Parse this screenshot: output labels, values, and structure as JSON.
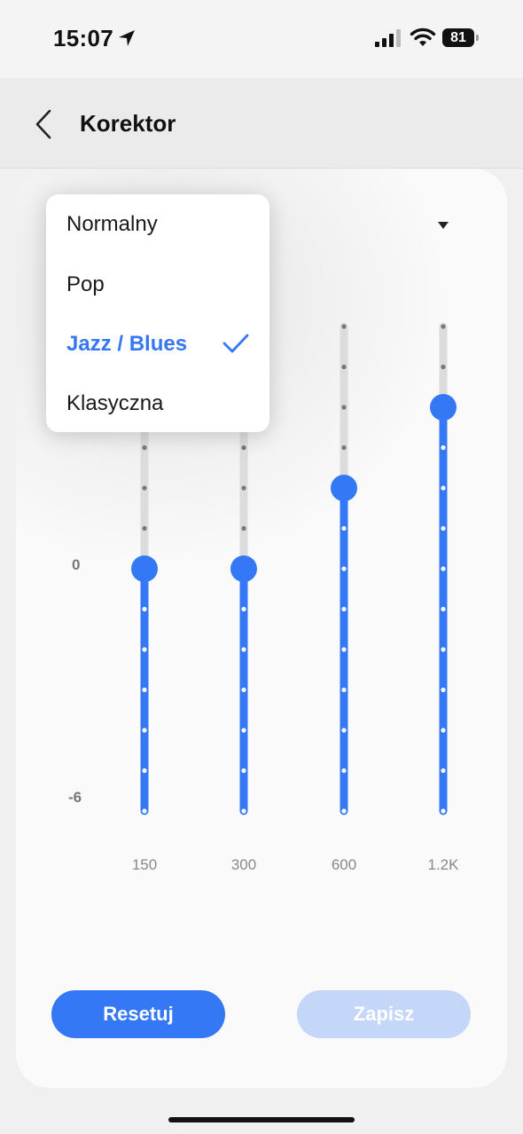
{
  "status_bar": {
    "time": "15:07",
    "battery": "81"
  },
  "header": {
    "title": "Korektor"
  },
  "dropdown": {
    "options": [
      "Normalny",
      "Pop",
      "Jazz / Blues",
      "Klasyczna"
    ],
    "selected_index": 2
  },
  "equalizer": {
    "y_labels": {
      "zero": "0",
      "min": "-6"
    },
    "bands": [
      {
        "label": "150",
        "value": 0
      },
      {
        "label": "300",
        "value": 0
      },
      {
        "label": "600",
        "value": 2
      },
      {
        "label": "1.2K",
        "value": 4
      }
    ]
  },
  "buttons": {
    "reset_label": "Resetuj",
    "save_label": "Zapisz"
  },
  "colors": {
    "accent": "#3478f6",
    "accent_disabled": "#c5d7f8",
    "track": "#dcdcdc"
  }
}
